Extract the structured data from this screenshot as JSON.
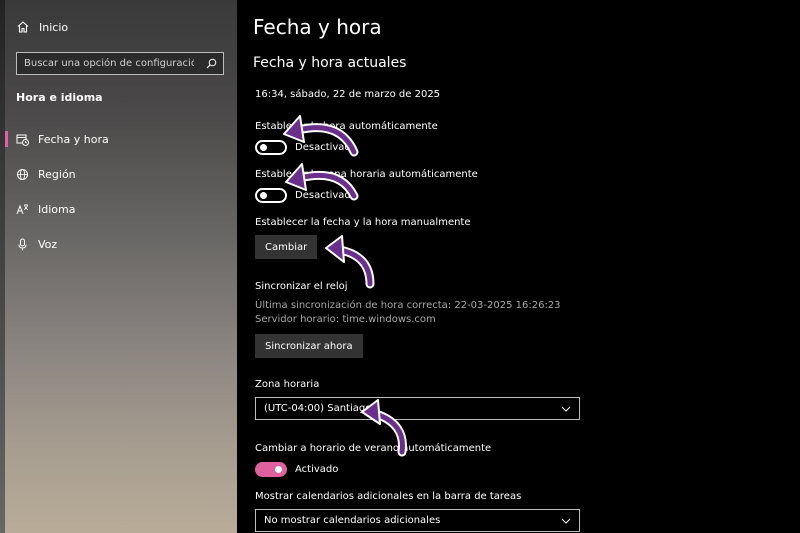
{
  "sidebar": {
    "home_label": "Inicio",
    "search_placeholder": "Buscar una opción de configuración",
    "section_title": "Hora e idioma",
    "items": [
      {
        "label": "Fecha y hora",
        "icon": "calendar-clock-icon"
      },
      {
        "label": "Región",
        "icon": "globe-icon"
      },
      {
        "label": "Idioma",
        "icon": "language-icon"
      },
      {
        "label": "Voz",
        "icon": "microphone-icon"
      }
    ]
  },
  "main": {
    "title": "Fecha y hora",
    "subtitle": "Fecha y hora actuales",
    "current_datetime": "16:34, sábado, 22 de marzo de 2025",
    "auto_time": {
      "label": "Establecer la hora automáticamente",
      "state": "Desactivado"
    },
    "auto_timezone": {
      "label": "Establecer la zona horaria automáticamente",
      "state": "Desactivado"
    },
    "manual": {
      "label": "Establecer la fecha y la hora manualmente",
      "button": "Cambiar"
    },
    "sync": {
      "label": "Sincronizar el reloj",
      "last_sync": "Última sincronización de hora correcta: 22-03-2025 16:26:23",
      "server": "Servidor horario: time.windows.com",
      "button": "Sincronizar ahora"
    },
    "timezone": {
      "label": "Zona horaria",
      "value": "(UTC-04:00) Santiago"
    },
    "dst": {
      "label": "Cambiar a horario de verano automáticamente",
      "state": "Activado"
    },
    "calendars": {
      "label": "Mostrar calendarios adicionales en la barra de tareas",
      "value": "No mostrar calendarios adicionales"
    }
  },
  "colors": {
    "accent": "#e060a0",
    "arrow": "#6a2e8c"
  }
}
